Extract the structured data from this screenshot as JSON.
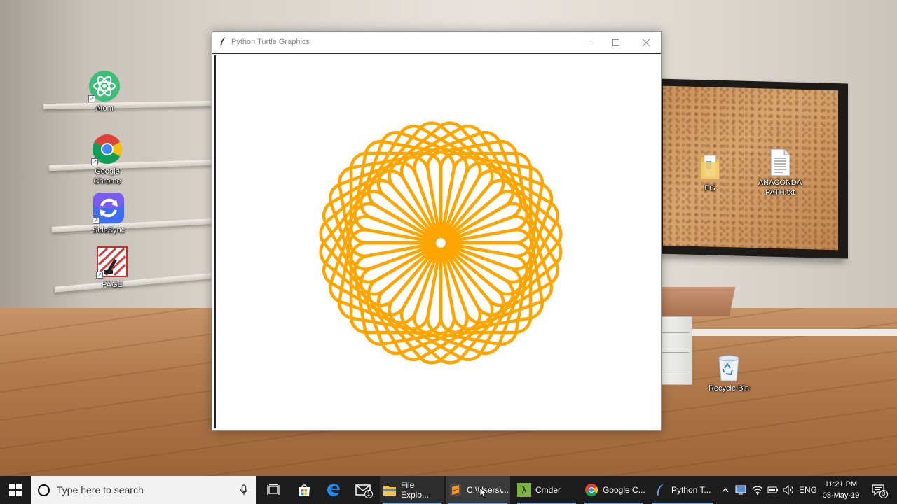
{
  "desktop": {
    "icons_left": [
      {
        "label": "Atom",
        "icon": "atom-icon"
      },
      {
        "label": "Google\nChrome",
        "icon": "chrome-icon"
      },
      {
        "label": "SideSync",
        "icon": "sidesync-icon"
      },
      {
        "label": "PAGE",
        "icon": "page-icon"
      }
    ],
    "icons_right": [
      {
        "label": "FG",
        "icon": "folder-icon"
      },
      {
        "label": "ANACONDA\nPATH.txt",
        "icon": "text-file-icon"
      },
      {
        "label": "Recycle Bin",
        "icon": "recycle-bin-icon"
      }
    ]
  },
  "window": {
    "title": "Python Turtle Graphics",
    "buttons": [
      "minimize-icon",
      "maximize-icon",
      "close-icon"
    ],
    "drawing": {
      "stroke_color": "#FFA500",
      "petal_count": 36,
      "shape": "circle of overlapping rounded squares (spirograph)"
    }
  },
  "taskbar": {
    "search_placeholder": "Type here to search",
    "pinned": [
      "task-view-icon",
      "store-icon",
      "edge-icon",
      "mail-icon"
    ],
    "mail_badge": "1",
    "apps": [
      {
        "label": "File Explo...",
        "icon": "file-explorer-icon"
      },
      {
        "label": "C:\\Users\\...",
        "icon": "sublime-icon"
      },
      {
        "label": "Cmder",
        "icon": "cmder-icon"
      },
      {
        "label": "Google C...",
        "icon": "chrome-icon"
      },
      {
        "label": "Python T...",
        "icon": "python-feather-icon"
      }
    ],
    "tray": {
      "language": "ENG",
      "time": "11:21 PM",
      "date": "08-May-19",
      "notification_count": "3"
    }
  }
}
